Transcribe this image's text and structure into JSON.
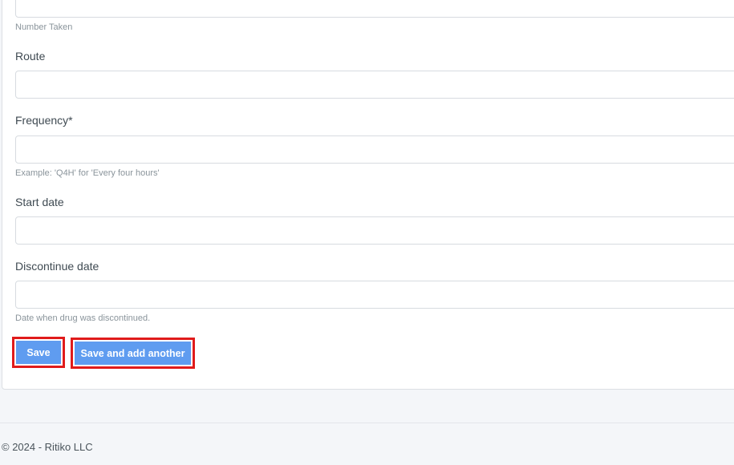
{
  "form": {
    "number_taken_help": "Number Taken",
    "route_label": "Route",
    "route_value": "",
    "frequency_label": "Frequency*",
    "frequency_value": "",
    "frequency_help": "Example: 'Q4H' for 'Every four hours'",
    "start_date_label": "Start date",
    "start_date_value": "",
    "discontinue_date_label": "Discontinue date",
    "discontinue_date_value": "",
    "discontinue_date_help": "Date when drug was discontinued."
  },
  "buttons": {
    "save_label": "Save",
    "save_add_label": "Save and add another"
  },
  "footer": {
    "copyright": "© 2024 - Ritiko LLC"
  },
  "colors": {
    "button_bg": "#5f9cf0",
    "highlight_border": "#e01b1b",
    "page_bg": "#f4f6f9"
  }
}
